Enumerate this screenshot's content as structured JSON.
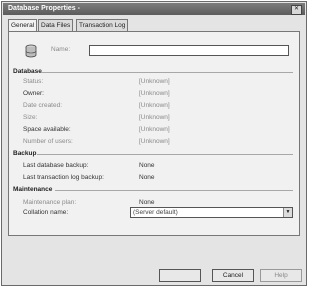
{
  "window": {
    "title": "Database Properties -",
    "close_glyph": "✕"
  },
  "tabs": [
    {
      "label": "General"
    },
    {
      "label": "Data Files"
    },
    {
      "label": "Transaction Log"
    }
  ],
  "general": {
    "name_label": "Name:",
    "name_value": ""
  },
  "database_section": {
    "heading": "Database",
    "rows": [
      {
        "label": "Status:",
        "value": "[Unknown]"
      },
      {
        "label": "Owner:",
        "value": "[Unknown]"
      },
      {
        "label": "Date created:",
        "value": "[Unknown]"
      },
      {
        "label": "Size:",
        "value": "[Unknown]"
      },
      {
        "label": "Space available:",
        "value": "[Unknown]"
      },
      {
        "label": "Number of users:",
        "value": "[Unknown]"
      }
    ]
  },
  "backup_section": {
    "heading": "Backup",
    "rows": [
      {
        "label": "Last database backup:",
        "value": "None"
      },
      {
        "label": "Last transaction log backup:",
        "value": "None"
      }
    ]
  },
  "maintenance_section": {
    "heading": "Maintenance",
    "rows": [
      {
        "label": "Maintenance plan:",
        "value": "None"
      }
    ],
    "collation_label": "Collation name:",
    "collation_value": "(Server default)"
  },
  "buttons": {
    "ok": "",
    "cancel": "Cancel",
    "help": "Help"
  },
  "icons": {
    "database": "database-icon",
    "close": "close-icon",
    "dropdown": "chevron-down-icon"
  }
}
